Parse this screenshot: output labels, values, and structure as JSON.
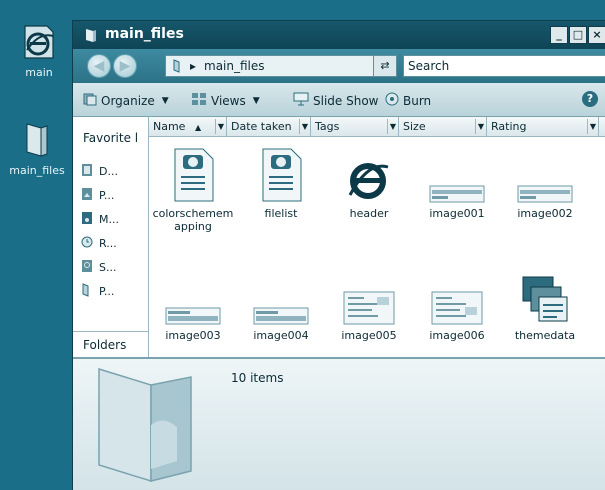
{
  "desktop": {
    "icons": [
      {
        "label": "main",
        "icon": "ie-icon"
      },
      {
        "label": "main_files",
        "icon": "folder-icon"
      }
    ]
  },
  "window": {
    "title": "main_files",
    "controls": {
      "minimize": "_",
      "maximize": "□",
      "close": "×"
    }
  },
  "address": {
    "path": "main_files",
    "separator": "▸",
    "search_placeholder": "Search"
  },
  "toolbar": {
    "organize": "Organize",
    "views": "Views",
    "slideshow": "Slide Show",
    "burn": "Burn",
    "help": "?"
  },
  "navpane": {
    "favorites": "Favorite l",
    "links": [
      "D...",
      "P...",
      "M...",
      "R...",
      "S...",
      "P..."
    ],
    "folders": "Folders"
  },
  "columns": [
    "Name",
    "Date taken",
    "Tags",
    "Size",
    "Rating"
  ],
  "files": [
    {
      "name": "colorschemem apping",
      "type": "html-doc"
    },
    {
      "name": "filelist",
      "type": "html-doc"
    },
    {
      "name": "header",
      "type": "ie-doc"
    },
    {
      "name": "image001",
      "type": "image-thumb"
    },
    {
      "name": "image002",
      "type": "image-thumb"
    },
    {
      "name": "image003",
      "type": "image-thumb"
    },
    {
      "name": "image004",
      "type": "image-thumb"
    },
    {
      "name": "image005",
      "type": "doc-thumb"
    },
    {
      "name": "image006",
      "type": "doc-thumb"
    },
    {
      "name": "themedata",
      "type": "theme-doc"
    }
  ],
  "details": {
    "item_count": "10 items"
  },
  "colors": {
    "desktop": "#1a6e87",
    "titlebar": "#0f4556",
    "pane": "#ffffff"
  }
}
